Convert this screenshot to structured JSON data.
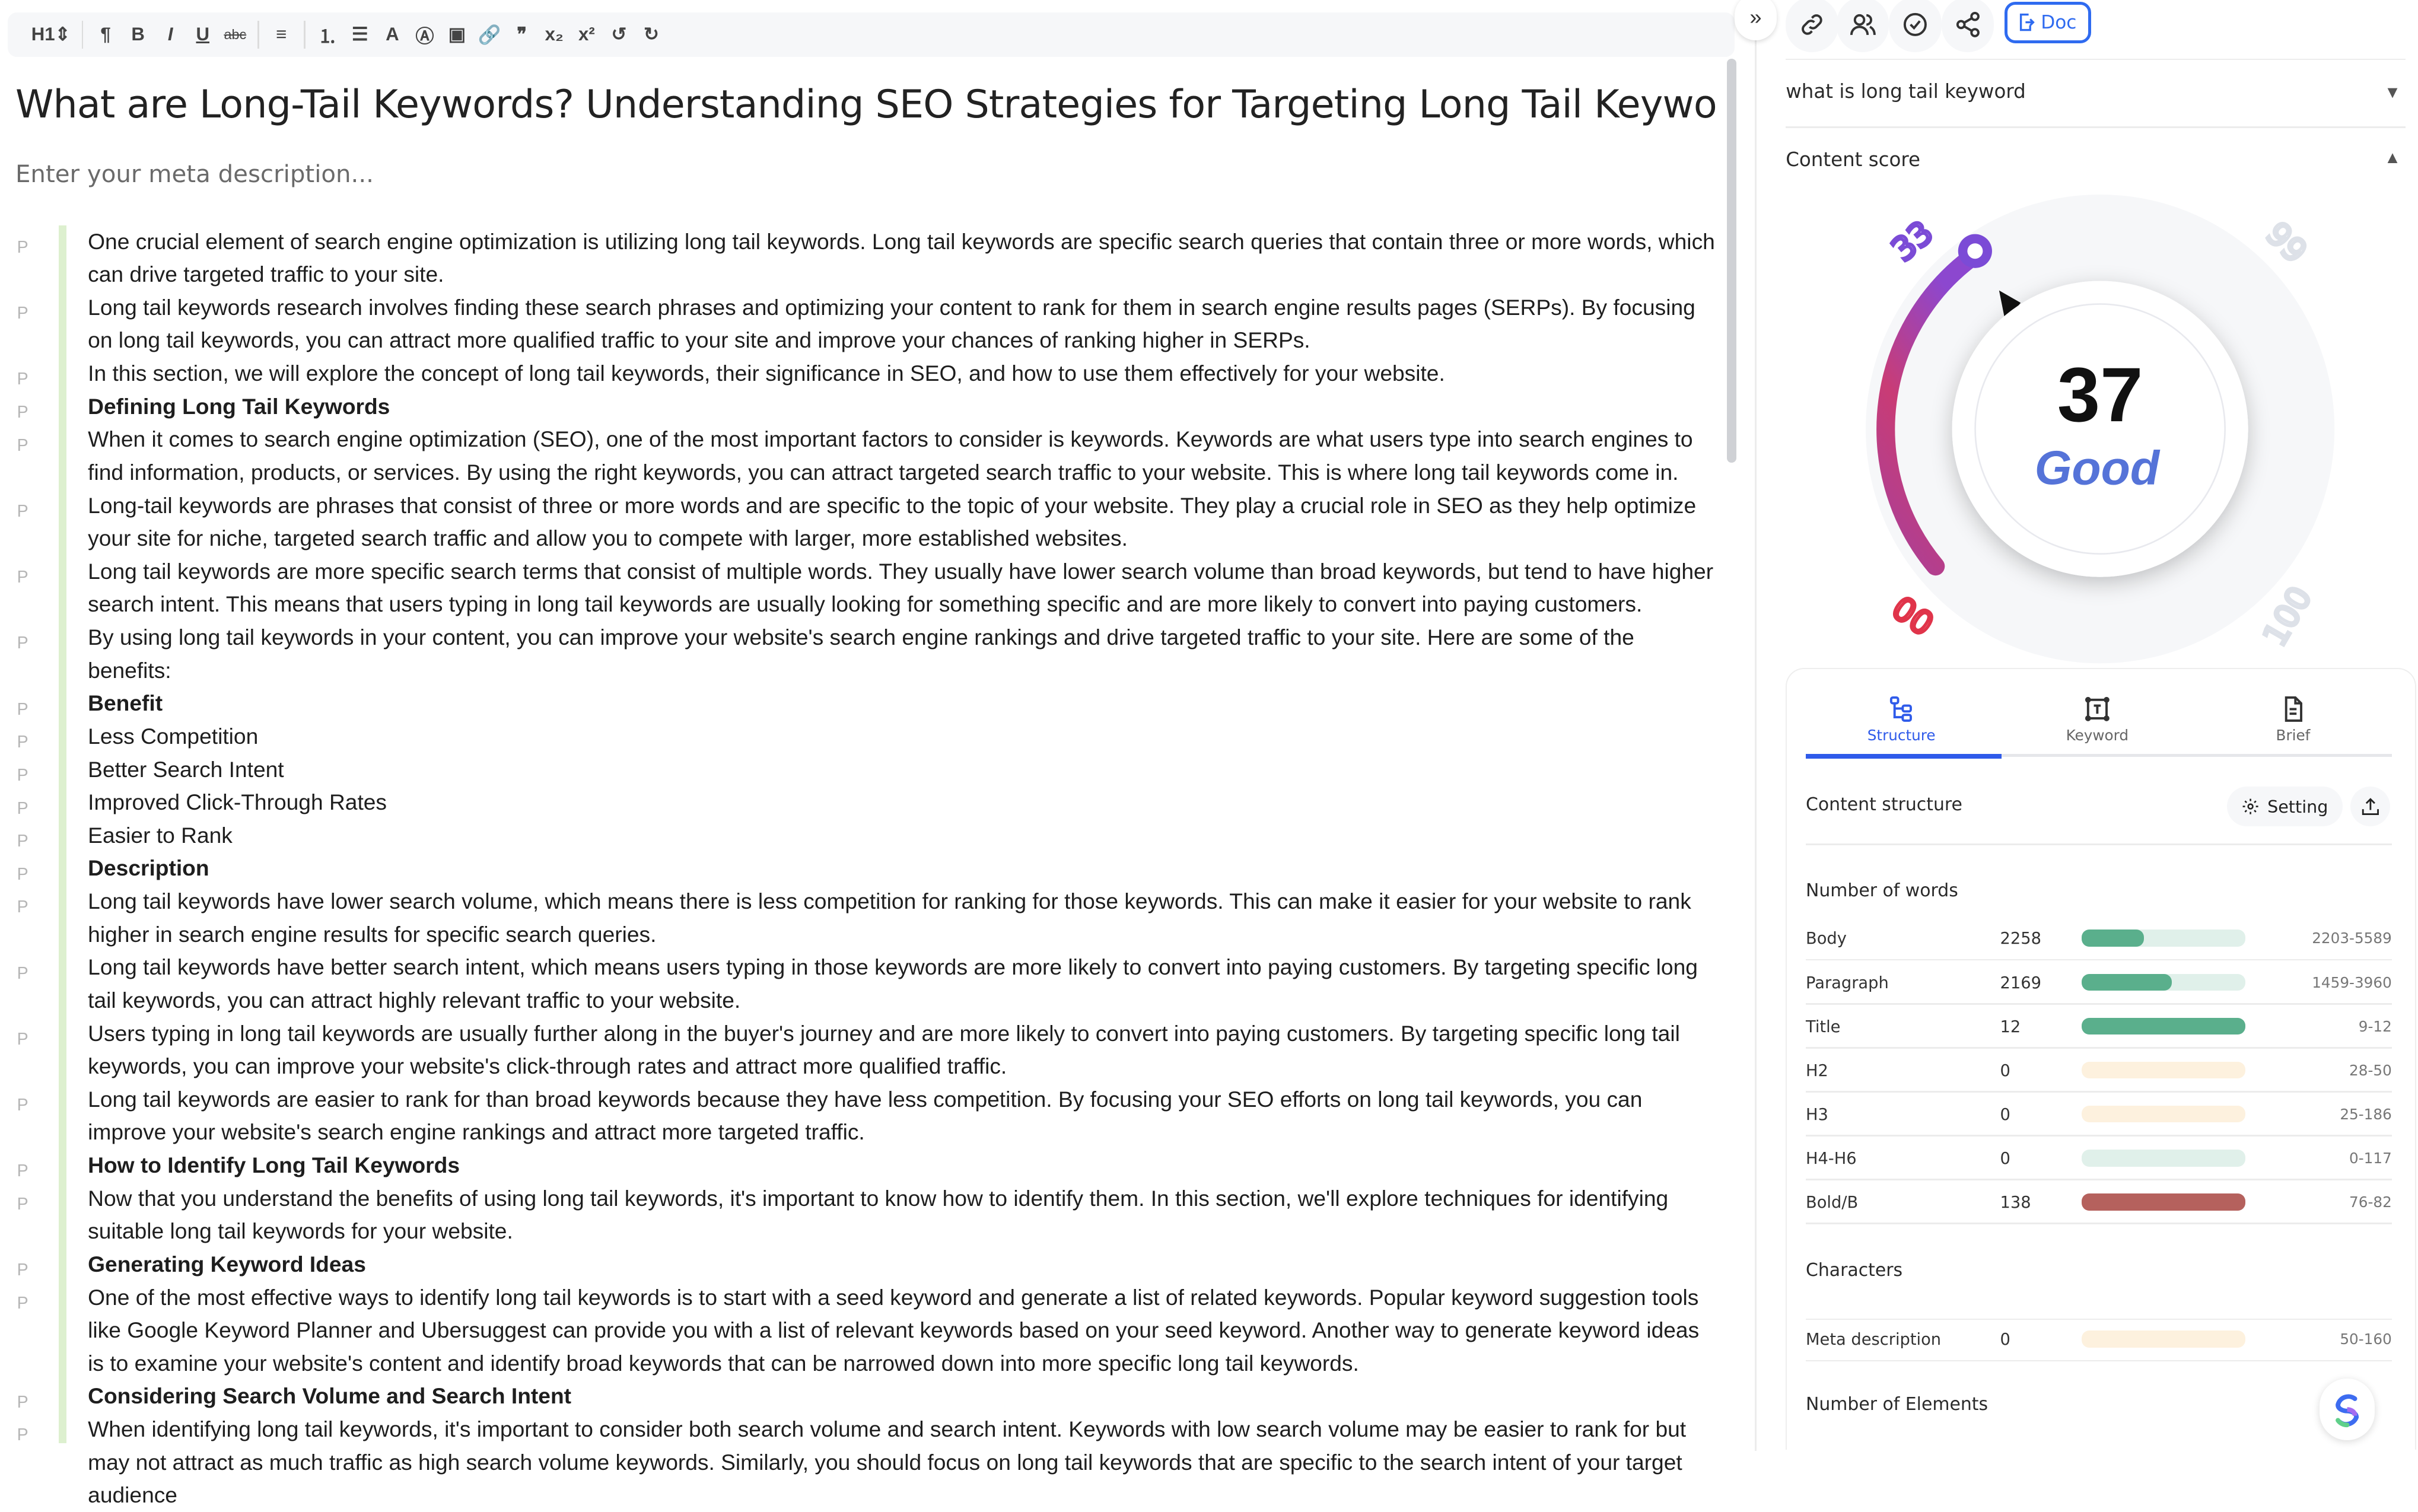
{
  "toolbar": {
    "items": [
      {
        "glyph": "H1⇕",
        "icon": "heading-select-icon"
      },
      {
        "sep": true
      },
      {
        "glyph": "¶",
        "icon": "paragraph-icon"
      },
      {
        "glyph": "B",
        "icon": "bold-icon"
      },
      {
        "glyph": "I",
        "icon": "italic-icon"
      },
      {
        "glyph": "U",
        "icon": "underline-icon"
      },
      {
        "glyph": "abc",
        "icon": "strikethrough-icon"
      },
      {
        "sep": true
      },
      {
        "glyph": "≡",
        "icon": "align-icon"
      },
      {
        "sep": true
      },
      {
        "glyph": "⒈",
        "icon": "ordered-list-icon"
      },
      {
        "glyph": "☰",
        "icon": "bullet-list-icon"
      },
      {
        "glyph": "A",
        "icon": "font-color-icon"
      },
      {
        "glyph": "Ⓐ",
        "icon": "highlight-icon"
      },
      {
        "glyph": "▣",
        "icon": "image-icon"
      },
      {
        "glyph": "🔗",
        "icon": "link-icon"
      },
      {
        "glyph": "❞",
        "icon": "quote-icon"
      },
      {
        "glyph": "x₂",
        "icon": "subscript-icon"
      },
      {
        "glyph": "x²",
        "icon": "superscript-icon"
      },
      {
        "glyph": "↺",
        "icon": "undo-icon"
      },
      {
        "glyph": "↻",
        "icon": "redo-icon"
      }
    ]
  },
  "editor": {
    "title": "What are Long-Tail Keywords? Understanding SEO Strategies for Targeting Long Tail Keywords",
    "meta_placeholder": "Enter your meta description...",
    "paragraph_marker": "P",
    "blocks": [
      {
        "h": false,
        "text": "One crucial element of search engine optimization is utilizing long tail keywords. Long tail keywords are specific search queries that contain three or more words, which can drive targeted traffic to your site."
      },
      {
        "h": false,
        "text": "Long tail keywords research involves finding these search phrases and optimizing your content to rank for them in search engine results pages (SERPs). By focusing on long tail keywords, you can attract more qualified traffic to your site and improve your chances of ranking higher in SERPs."
      },
      {
        "h": false,
        "text": "In this section, we will explore the concept of long tail keywords, their significance in SEO, and how to use them effectively for your website."
      },
      {
        "h": true,
        "text": "Defining Long Tail Keywords"
      },
      {
        "h": false,
        "text": "When it comes to search engine optimization (SEO), one of the most important factors to consider is keywords. Keywords are what users type into search engines to find information, products, or services. By using the right keywords, you can attract targeted search traffic to your website. This is where long tail keywords come in."
      },
      {
        "h": false,
        "text": "Long-tail keywords are phrases that consist of three or more words and are specific to the topic of your website. They play a crucial role in SEO as they help optimize your site for niche, targeted search traffic and allow you to compete with larger, more established websites."
      },
      {
        "h": false,
        "text": "Long tail keywords are more specific search terms that consist of multiple words. They usually have lower search volume than broad keywords, but tend to have higher search intent. This means that users typing in long tail keywords are usually looking for something specific and are more likely to convert into paying customers."
      },
      {
        "h": false,
        "text": "By using long tail keywords in your content, you can improve your website's search engine rankings and drive targeted traffic to your site. Here are some of the benefits:"
      },
      {
        "h": true,
        "text": "Benefit"
      },
      {
        "h": false,
        "text": "Less Competition"
      },
      {
        "h": false,
        "text": "Better Search Intent"
      },
      {
        "h": false,
        "text": "Improved Click-Through Rates"
      },
      {
        "h": false,
        "text": "Easier to Rank"
      },
      {
        "h": true,
        "text": "Description"
      },
      {
        "h": false,
        "text": "Long tail keywords have lower search volume, which means there is less competition for ranking for those keywords. This can make it easier for your website to rank higher in search engine results for specific search queries."
      },
      {
        "h": false,
        "text": "Long tail keywords have better search intent, which means users typing in those keywords are more likely to convert into paying customers. By targeting specific long tail keywords, you can attract highly relevant traffic to your website."
      },
      {
        "h": false,
        "text": "Users typing in long tail keywords are usually further along in the buyer's journey and are more likely to convert into paying customers. By targeting specific long tail keywords, you can improve your website's click-through rates and attract more qualified traffic."
      },
      {
        "h": false,
        "text": "Long tail keywords are easier to rank for than broad keywords because they have less competition. By focusing your SEO efforts on long tail keywords, you can improve your website's search engine rankings and attract more targeted traffic."
      },
      {
        "h": true,
        "text": "How to Identify Long Tail Keywords"
      },
      {
        "h": false,
        "text": "Now that you understand the benefits of using long tail keywords, it's important to know how to identify them. In this section, we'll explore techniques for identifying suitable long tail keywords for your website."
      },
      {
        "h": true,
        "text": "Generating Keyword Ideas"
      },
      {
        "h": false,
        "text": "One of the most effective ways to identify long tail keywords is to start with a seed keyword and generate a list of related keywords. Popular keyword suggestion tools like Google Keyword Planner and Ubersuggest can provide you with a list of relevant keywords based on your seed keyword. Another way to generate keyword ideas is to examine your website's content and identify broad keywords that can be narrowed down into more specific long tail keywords."
      },
      {
        "h": true,
        "text": "Considering Search Volume and Search Intent"
      },
      {
        "h": false,
        "text": "When identifying long tail keywords, it's important to consider both search volume and search intent. Keywords with low search volume may be easier to rank for but may not attract as much traffic as high search volume keywords. Similarly, you should focus on long tail keywords that are specific to the search intent of your target audience"
      }
    ]
  },
  "panel": {
    "collapse_glyph": "»",
    "doc_label": "Doc",
    "keyword": "what is long tail keyword",
    "content_score_label": "Content score",
    "score": {
      "value": 37,
      "label": "Good",
      "min": 0,
      "max": 100,
      "ticks": [
        "00",
        "33",
        "66",
        "100"
      ],
      "colors": {
        "arc_start": "#c93c75",
        "arc_end": "#8c47cf",
        "knob": "#7b4bd6",
        "label": "#5573d8",
        "tick_low": "#e0344a",
        "tick_active": "#7b4bd6",
        "tick_inactive": "#dde1e8"
      }
    },
    "tabs": [
      {
        "label": "Structure",
        "icon": "structure-icon",
        "active": true
      },
      {
        "label": "Keyword",
        "icon": "keyword-icon",
        "active": false
      },
      {
        "label": "Brief",
        "icon": "brief-icon",
        "active": false
      }
    ],
    "content_structure_label": "Content structure",
    "setting_label": "Setting",
    "words_label": "Number of words",
    "word_rows": [
      {
        "label": "Body",
        "value": "2258",
        "range": "2203-5589",
        "fill": 0.38,
        "status": "good"
      },
      {
        "label": "Paragraph",
        "value": "2169",
        "range": "1459-3960",
        "fill": 0.55,
        "status": "good"
      },
      {
        "label": "Title",
        "value": "12",
        "range": "9-12",
        "fill": 1,
        "status": "good"
      },
      {
        "label": "H2",
        "value": "0",
        "range": "28-50",
        "fill": 0,
        "status": "warn"
      },
      {
        "label": "H3",
        "value": "0",
        "range": "25-186",
        "fill": 0,
        "status": "warn"
      },
      {
        "label": "H4-H6",
        "value": "0",
        "range": "0-117",
        "fill": 0,
        "status": "good"
      },
      {
        "label": "Bold/B",
        "value": "138",
        "range": "76-82",
        "fill": 1,
        "status": "bad"
      }
    ],
    "characters_label": "Characters",
    "char_rows": [
      {
        "label": "Meta description",
        "value": "0",
        "range": "50-160",
        "fill": 0,
        "status": "warn"
      }
    ],
    "elements_label": "Number of Elements",
    "status_colors": {
      "good": {
        "track": "#e0f0ea",
        "fill": "#5aaf8c"
      },
      "warn": {
        "track": "#fdf1de",
        "fill": "#f2c27a"
      },
      "bad": {
        "track": "#f3dcdb",
        "fill": "#b5615d"
      }
    }
  }
}
